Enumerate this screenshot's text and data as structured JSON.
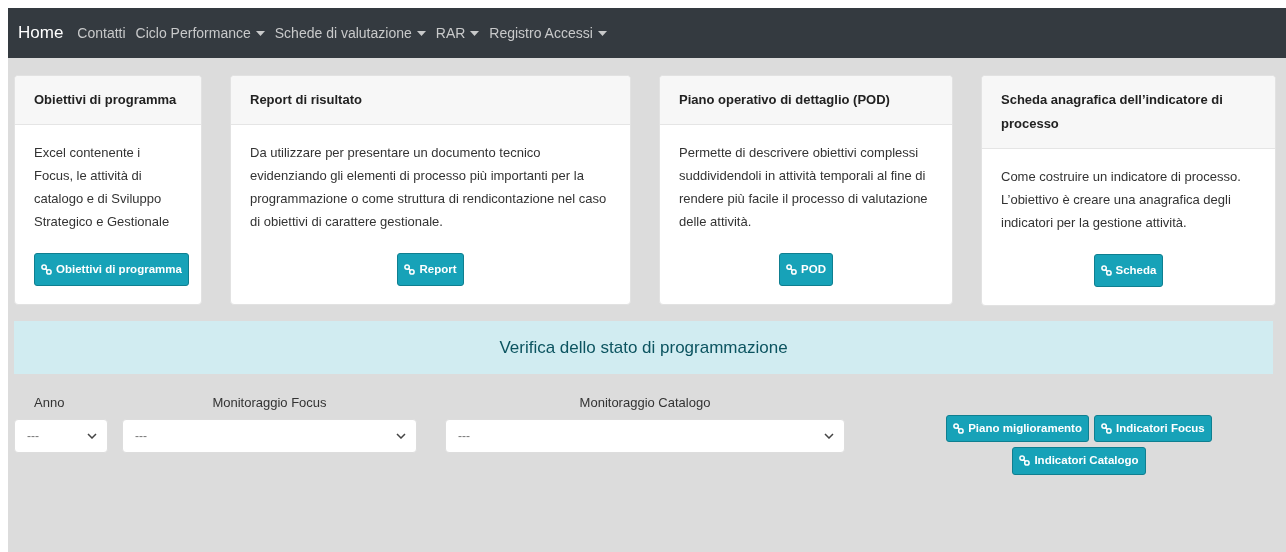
{
  "navbar": {
    "brand": "Home",
    "items": [
      {
        "label": "Contatti",
        "dropdown": false
      },
      {
        "label": "Ciclo Performance",
        "dropdown": true
      },
      {
        "label": "Schede di valutazione",
        "dropdown": true
      },
      {
        "label": "RAR",
        "dropdown": true
      },
      {
        "label": "Registro Accessi",
        "dropdown": true
      }
    ]
  },
  "cards": [
    {
      "title": "Obiettivi di programma",
      "text": "Excel contenente i Focus, le attività di catalogo e di Sviluppo Strategico e Gestionale",
      "button": "Obiettivi di programma"
    },
    {
      "title": "Report di risultato",
      "text": "Da utilizzare per presentare un documento tecnico evidenziando gli elementi di processo più importanti per la programmazione o come struttura di rendicontazione nel caso di obiettivi di carattere gestionale.",
      "button": "Report"
    },
    {
      "title": "Piano operativo di dettaglio (POD)",
      "text": "Permette di descrivere obiettivi complessi suddividendoli in attività temporali al fine di rendere più facile il processo di valutazione delle attività.",
      "button": "POD"
    },
    {
      "title": "Scheda anagrafica dell’indicatore di processo",
      "text": "Come costruire un indicatore di processo. L’obiettivo è creare una anagrafica degli indicatori per la gestione attività.",
      "button": "Scheda"
    }
  ],
  "banner": "Verifica dello stato di programmazione",
  "filters": [
    {
      "label": "Anno",
      "value": "---"
    },
    {
      "label": "Monitoraggio Focus",
      "value": "---"
    },
    {
      "label": "Monitoraggio Catalogo",
      "value": "---"
    }
  ],
  "buttons": [
    "Piano miglioramento",
    "Indicatori Focus",
    "Indicatori Catalogo"
  ]
}
